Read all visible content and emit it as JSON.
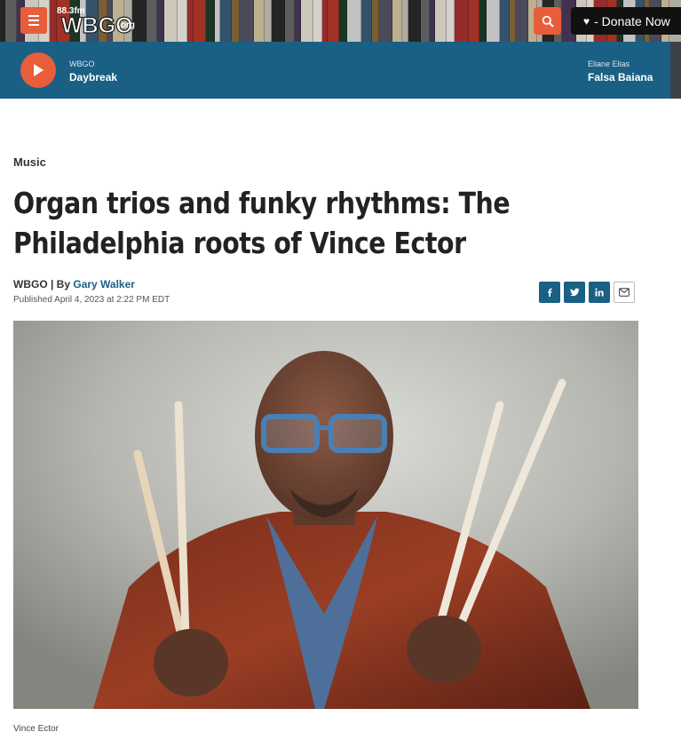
{
  "header": {
    "logo_text": "88.3fm WBGO.org",
    "donate_label": "- Donate Now",
    "icons": {
      "menu": "hamburger-icon",
      "search": "search-icon",
      "heart": "heart-icon"
    }
  },
  "player": {
    "station_label": "WBGO",
    "show_title": "Daybreak",
    "now_playing_artist": "Eliane Elias",
    "now_playing_track": "Falsa Baiana"
  },
  "article": {
    "category": "Music",
    "headline": "Organ trios and funky rhythms: The Philadelphia roots of Vince Ector",
    "byline_prefix": "WBGO | By ",
    "author": "Gary Walker",
    "published": "Published April 4, 2023 at 2:22 PM EDT",
    "share_icons": [
      "facebook-icon",
      "twitter-icon",
      "linkedin-icon",
      "email-icon"
    ],
    "photo_caption": "Vince Ector"
  },
  "colors": {
    "accent": "#e85d3a",
    "player_bg": "#1a5f84",
    "link": "#1a5f84",
    "donate_bg": "#111111"
  }
}
